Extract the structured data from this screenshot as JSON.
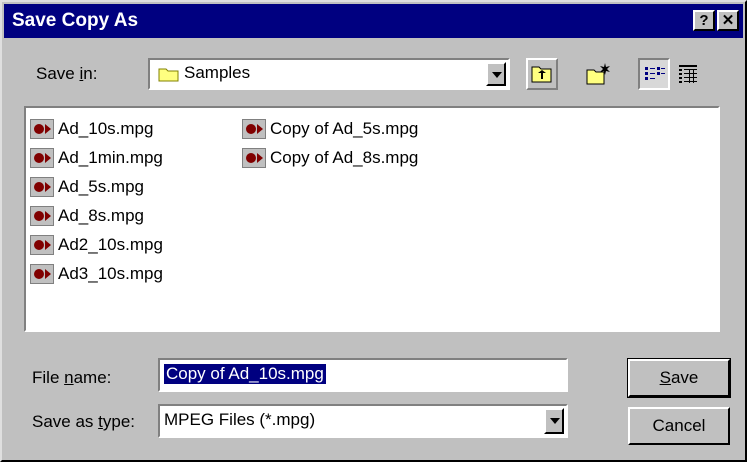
{
  "window": {
    "title": "Save Copy As",
    "help_glyph": "?",
    "close_glyph": "✕"
  },
  "save_in": {
    "label_prefix": "Save ",
    "label_underlined": "i",
    "label_suffix": "n:",
    "value": "Samples"
  },
  "toolbar": {
    "up_one_level": "up-folder-icon",
    "new_folder": "new-folder-icon",
    "list_view": "list-view-icon",
    "details_view": "details-view-icon"
  },
  "files": {
    "column1": [
      "Ad_10s.mpg",
      "Ad_1min.mpg",
      "Ad_5s.mpg",
      "Ad_8s.mpg",
      "Ad2_10s.mpg",
      "Ad3_10s.mpg"
    ],
    "column2": [
      "Copy of Ad_5s.mpg",
      "Copy of Ad_8s.mpg"
    ]
  },
  "file_name": {
    "label_prefix": "File ",
    "label_underlined": "n",
    "label_suffix": "ame:",
    "value": "Copy of Ad_10s.mpg"
  },
  "save_as_type": {
    "label_prefix": "Save as ",
    "label_underlined": "t",
    "label_suffix": "ype:",
    "value": "MPEG Files (*.mpg)"
  },
  "buttons": {
    "save_underlined": "S",
    "save_rest": "ave",
    "cancel": "Cancel"
  },
  "colors": {
    "title_bar": "#000080",
    "face": "#c0c0c0",
    "selection": "#000080",
    "file_icon": "#800000"
  }
}
